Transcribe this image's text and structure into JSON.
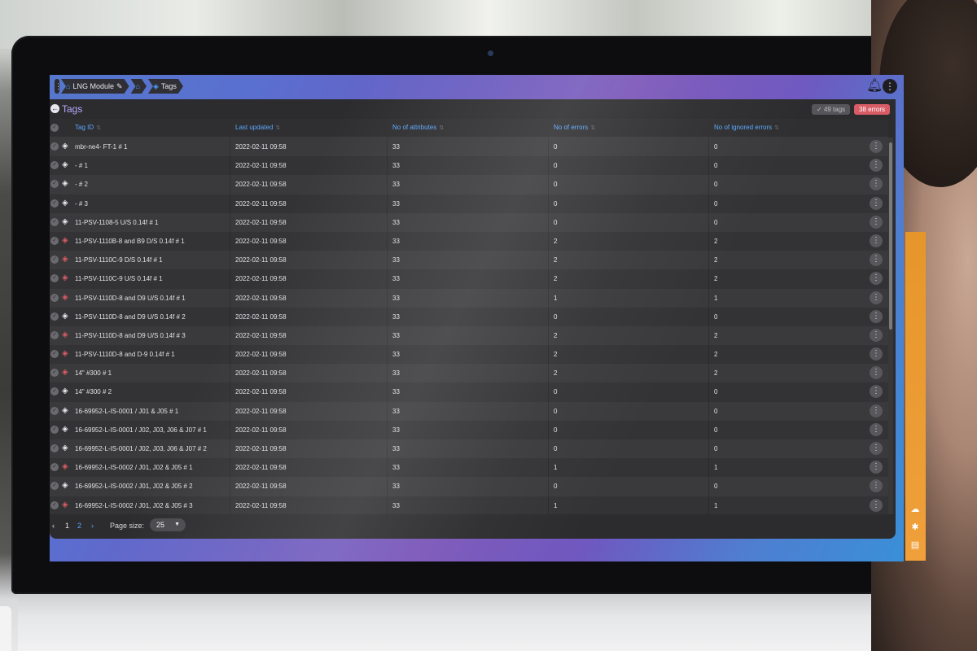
{
  "breadcrumbs": [
    {
      "label": "LNG Module",
      "icon": "home-icon"
    },
    {
      "label": "",
      "icon": "home-icon"
    },
    {
      "label": "Tags",
      "icon": "tag-icon"
    }
  ],
  "page": {
    "title": "Tags",
    "tags_badge": "49 tags",
    "errors_badge": "38 errors"
  },
  "columns": [
    "Tag ID",
    "Last updated",
    "No of attributes",
    "No of errors",
    "No of ignored errors"
  ],
  "rows": [
    {
      "tag_id": "mbr-ne4- FT-1 # 1",
      "last_updated": "2022-02-11 09:58",
      "attributes": "33",
      "errors": "0",
      "ignored": "0",
      "status": "ok"
    },
    {
      "tag_id": "- # 1",
      "last_updated": "2022-02-11 09:58",
      "attributes": "33",
      "errors": "0",
      "ignored": "0",
      "status": "ok"
    },
    {
      "tag_id": "- # 2",
      "last_updated": "2022-02-11 09:58",
      "attributes": "33",
      "errors": "0",
      "ignored": "0",
      "status": "ok"
    },
    {
      "tag_id": "- # 3",
      "last_updated": "2022-02-11 09:58",
      "attributes": "33",
      "errors": "0",
      "ignored": "0",
      "status": "ok"
    },
    {
      "tag_id": "11-PSV-1108-5 U/S 0.14f # 1",
      "last_updated": "2022-02-11 09:58",
      "attributes": "33",
      "errors": "0",
      "ignored": "0",
      "status": "ok"
    },
    {
      "tag_id": "11-PSV-1110B-8 and B9 D/S 0.14f # 1",
      "last_updated": "2022-02-11 09:58",
      "attributes": "33",
      "errors": "2",
      "ignored": "2",
      "status": "error"
    },
    {
      "tag_id": "11-PSV-1110C-9 D/S 0.14f # 1",
      "last_updated": "2022-02-11 09:58",
      "attributes": "33",
      "errors": "2",
      "ignored": "2",
      "status": "error"
    },
    {
      "tag_id": "11-PSV-1110C-9 U/S 0.14f # 1",
      "last_updated": "2022-02-11 09:58",
      "attributes": "33",
      "errors": "2",
      "ignored": "2",
      "status": "error"
    },
    {
      "tag_id": "11-PSV-1110D-8 and D9 U/S 0.14f # 1",
      "last_updated": "2022-02-11 09:58",
      "attributes": "33",
      "errors": "1",
      "ignored": "1",
      "status": "error"
    },
    {
      "tag_id": "11-PSV-1110D-8 and D9 U/S 0.14f # 2",
      "last_updated": "2022-02-11 09:58",
      "attributes": "33",
      "errors": "0",
      "ignored": "0",
      "status": "ok"
    },
    {
      "tag_id": "11-PSV-1110D-8 and D9 U/S 0.14f # 3",
      "last_updated": "2022-02-11 09:58",
      "attributes": "33",
      "errors": "2",
      "ignored": "2",
      "status": "error"
    },
    {
      "tag_id": "11-PSV-1110D-8 and D-9 0.14f # 1",
      "last_updated": "2022-02-11 09:58",
      "attributes": "33",
      "errors": "2",
      "ignored": "2",
      "status": "error"
    },
    {
      "tag_id": "14\" #300 # 1",
      "last_updated": "2022-02-11 09:58",
      "attributes": "33",
      "errors": "2",
      "ignored": "2",
      "status": "error"
    },
    {
      "tag_id": "14\" #300 # 2",
      "last_updated": "2022-02-11 09:58",
      "attributes": "33",
      "errors": "0",
      "ignored": "0",
      "status": "ok"
    },
    {
      "tag_id": "16-69952-L-IS-0001 / J01 & J05 # 1",
      "last_updated": "2022-02-11 09:58",
      "attributes": "33",
      "errors": "0",
      "ignored": "0",
      "status": "ok"
    },
    {
      "tag_id": "16-69952-L-IS-0001 / J02, J03, J06 & J07 # 1",
      "last_updated": "2022-02-11 09:58",
      "attributes": "33",
      "errors": "0",
      "ignored": "0",
      "status": "ok"
    },
    {
      "tag_id": "16-69952-L-IS-0001 / J02, J03, J06 & J07 # 2",
      "last_updated": "2022-02-11 09:58",
      "attributes": "33",
      "errors": "0",
      "ignored": "0",
      "status": "ok"
    },
    {
      "tag_id": "16-69952-L-IS-0002 / J01, J02 & J05 # 1",
      "last_updated": "2022-02-11 09:58",
      "attributes": "33",
      "errors": "1",
      "ignored": "1",
      "status": "error"
    },
    {
      "tag_id": "16-69952-L-IS-0002 / J01, J02 & J05 # 2",
      "last_updated": "2022-02-11 09:58",
      "attributes": "33",
      "errors": "0",
      "ignored": "0",
      "status": "ok"
    },
    {
      "tag_id": "16-69952-L-IS-0002 / J01, J02 & J05 # 3",
      "last_updated": "2022-02-11 09:58",
      "attributes": "33",
      "errors": "1",
      "ignored": "1",
      "status": "error"
    }
  ],
  "pagination": {
    "pages": [
      "1",
      "2"
    ],
    "current_page": "1",
    "page_size_label": "Page size:",
    "page_size": "25"
  },
  "colors": {
    "accent": "#5aa8ff",
    "error": "#d85c66",
    "title": "#b9a8ff"
  }
}
